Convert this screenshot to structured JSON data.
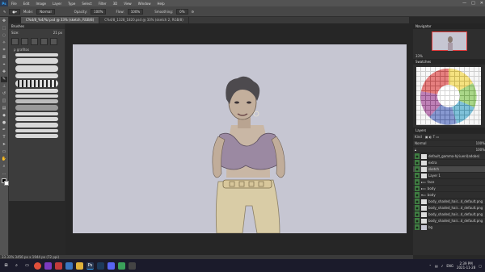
{
  "menubar": {
    "app_badge": "Ps",
    "items": [
      "File",
      "Edit",
      "Image",
      "Layer",
      "Type",
      "Select",
      "Filter",
      "3D",
      "View",
      "Window",
      "Help"
    ]
  },
  "window_controls": {
    "minimize": "—",
    "maximize": "□",
    "close": "✕"
  },
  "options": {
    "mode_label": "Mode:",
    "mode_value": "Normal",
    "opacity_label": "Opacity:",
    "opacity_value": "100%",
    "flow_label": "Flow:",
    "flow_value": "100%",
    "smoothing_label": "Smoothing:",
    "smoothing_value": "0%"
  },
  "tabs": [
    {
      "label": "C%4/8_%4/%/.psd @ 33% (sketch, RGB/8)"
    },
    {
      "label": "C%4/8_1328_1820.psd @ 33% (sketch 2, RGB/8)"
    }
  ],
  "brush_panel": {
    "title": "Brushes",
    "size_label": "Size:",
    "size_value": "21 px",
    "group_name": "p grafitos"
  },
  "navigator": {
    "title": "Navigator",
    "zoom": "33%"
  },
  "swatches": {
    "title": "Swatches"
  },
  "layers": {
    "title": "Layers",
    "kind_label": "Kind",
    "blend_mode": "Normal",
    "opacity": "100%",
    "fill": "100%",
    "rows": [
      {
        "name": "default_gamma-hjriuenl(adobe)",
        "selected": false
      },
      {
        "name": "extra",
        "selected": false
      },
      {
        "name": "sketch",
        "selected": true
      },
      {
        "name": "Layer 1",
        "selected": false
      },
      {
        "name": "face",
        "selected": false
      },
      {
        "name": "body",
        "selected": false
      },
      {
        "name": "body",
        "selected": false
      },
      {
        "name": "body_shaded_hair...d_default.png",
        "selected": false
      },
      {
        "name": "body_shaded_hair...d_default.png",
        "selected": false
      },
      {
        "name": "body_shaded_hair...d_default.png",
        "selected": false
      },
      {
        "name": "body_shaded_hair...d_default.png",
        "selected": false
      },
      {
        "name": "bg",
        "selected": false
      }
    ]
  },
  "status": {
    "text": "33.33%   3456 px x 1944 px (72 ppi)"
  },
  "taskbar": {
    "tray_lang": "ENG",
    "time": "2:39 PM",
    "date": "2021-11-28"
  },
  "colors": {
    "canvas_bg": "#c6c6d2",
    "accent": "#31a8ff"
  }
}
